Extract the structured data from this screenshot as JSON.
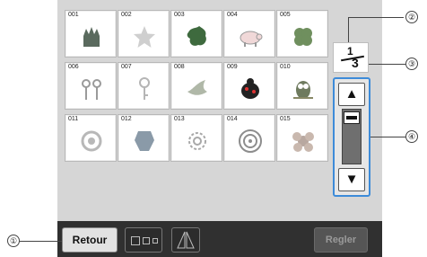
{
  "patterns": [
    {
      "num": "001",
      "icon": "crown-icon",
      "color": "#5a6a5e"
    },
    {
      "num": "002",
      "icon": "star-icon",
      "color": "#cfcfcf"
    },
    {
      "num": "003",
      "icon": "map-icon",
      "color": "#3e6a3e"
    },
    {
      "num": "004",
      "icon": "pig-icon",
      "color": "#9a9a9a"
    },
    {
      "num": "005",
      "icon": "clover-icon",
      "color": "#6f8f5e"
    },
    {
      "num": "006",
      "icon": "cherries-icon",
      "color": "#9a9a9a"
    },
    {
      "num": "007",
      "icon": "key-icon",
      "color": "#b5b5b5"
    },
    {
      "num": "008",
      "icon": "dove-icon",
      "color": "#b0b8a8"
    },
    {
      "num": "009",
      "icon": "ladybug-icon",
      "color": "#222222"
    },
    {
      "num": "010",
      "icon": "owl-icon",
      "color": "#6e7a5e"
    },
    {
      "num": "011",
      "icon": "ornament-icon",
      "color": "#b8b8b8"
    },
    {
      "num": "012",
      "icon": "lion-crest-icon",
      "color": "#8a9aa8"
    },
    {
      "num": "013",
      "icon": "filigree-icon",
      "color": "#a8a8a8"
    },
    {
      "num": "014",
      "icon": "medallion-icon",
      "color": "#8d8d8d"
    },
    {
      "num": "015",
      "icon": "floral-icon",
      "color": "#b8a8a0"
    }
  ],
  "page": {
    "current": "1",
    "total": "3"
  },
  "scroll": {
    "up_symbol": "▲",
    "down_symbol": "▼"
  },
  "buttons": {
    "retour": "Retour",
    "regler": "Regler"
  },
  "callouts": [
    "①",
    "②",
    "③",
    "④"
  ],
  "accent": "#3d8bd9"
}
